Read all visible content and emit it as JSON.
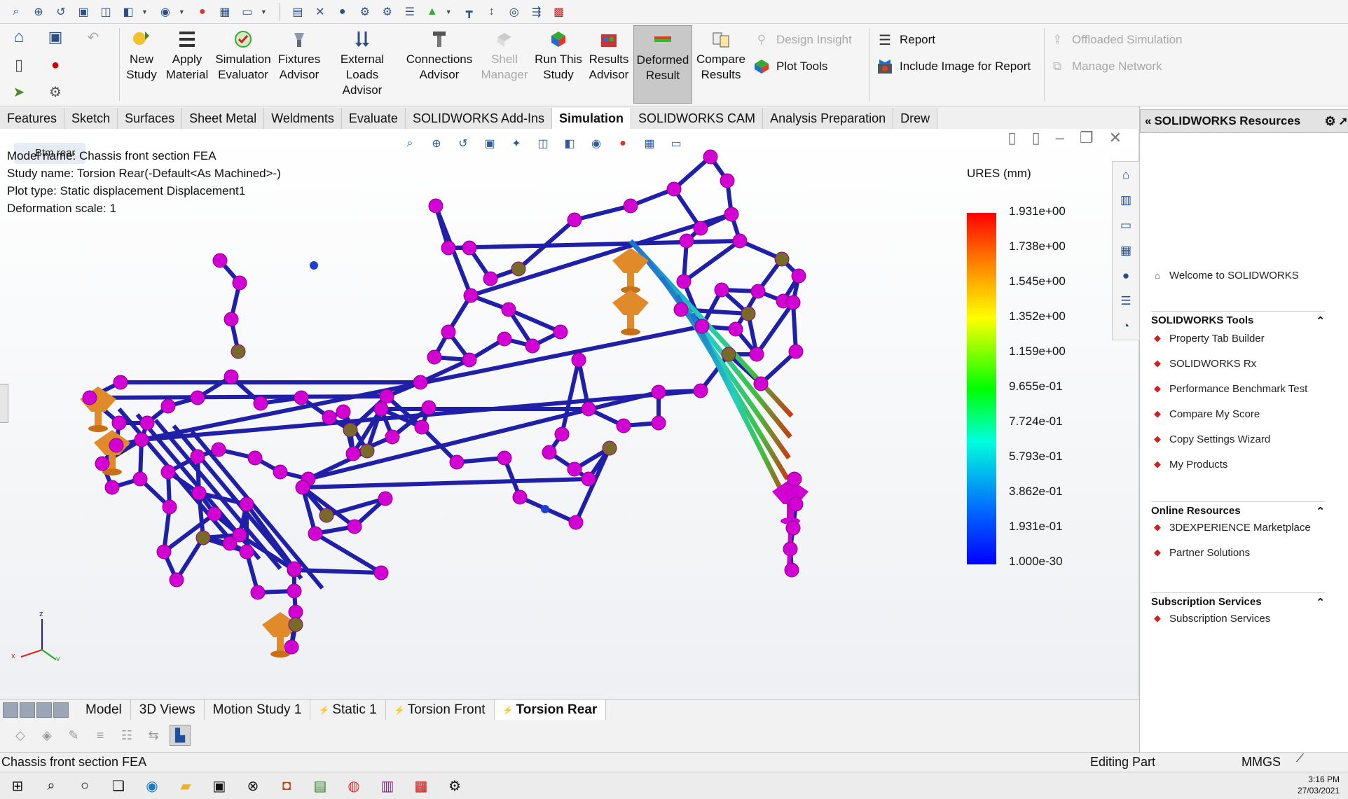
{
  "ribbon": {
    "new_study": "New\nStudy",
    "apply_material": "Apply\nMaterial",
    "simulation_evaluator": "Simulation\nEvaluator",
    "fixtures_advisor": "Fixtures\nAdvisor",
    "external_loads_advisor": "External\nLoads Advisor",
    "connections_advisor": "Connections\nAdvisor",
    "shell_manager": "Shell\nManager",
    "run_this_study": "Run This\nStudy",
    "results_advisor": "Results\nAdvisor",
    "deformed_result": "Deformed\nResult",
    "compare_results": "Compare\nResults",
    "design_insight": "Design Insight",
    "plot_tools": "Plot Tools",
    "report": "Report",
    "include_image": "Include Image for Report",
    "offloaded_simulation": "Offloaded Simulation",
    "manage_network": "Manage Network"
  },
  "command_tabs": [
    "Features",
    "Sketch",
    "Surfaces",
    "Sheet Metal",
    "Weldments",
    "Evaluate",
    "SOLIDWORKS Add-Ins",
    "Simulation",
    "SOLIDWORKS CAM",
    "Analysis Preparation",
    "Drew"
  ],
  "active_command_tab": "Simulation",
  "viewport": {
    "flyout_tag": "Btm rear",
    "model_name": "Model name: Chassis front section FEA",
    "study_name": "Study name: Torsion Rear(-Default<As Machined>-)",
    "plot_type": "Plot type: Static displacement Displacement1",
    "deformation_scale": "Deformation scale: 1"
  },
  "legend": {
    "title": "URES (mm)",
    "labels": [
      "1.931e+00",
      "1.738e+00",
      "1.545e+00",
      "1.352e+00",
      "1.159e+00",
      "9.655e-01",
      "7.724e-01",
      "5.793e-01",
      "3.862e-01",
      "1.931e-01",
      "1.000e-30"
    ],
    "colors": [
      "#ff0000",
      "#ff8800",
      "#ffff00",
      "#00ff00",
      "#00ffdd",
      "#0066ff",
      "#0000ff"
    ]
  },
  "triad": {
    "x": "x",
    "y": "y",
    "z": "z"
  },
  "model_tabs": [
    "Model",
    "3D Views",
    "Motion Study 1",
    "Static 1",
    "Torsion Front",
    "Torsion Rear"
  ],
  "active_model_tab": "Torsion Rear",
  "status": {
    "left": "Chassis front section FEA",
    "mode": "Editing Part",
    "units": "MMGS"
  },
  "clock": {
    "time": "3:16 PM",
    "date": "27/03/2021"
  },
  "task_pane": {
    "title": "SOLIDWORKS Resources",
    "welcome": "Welcome to SOLIDWORKS",
    "tools_header": "SOLIDWORKS Tools",
    "tools": [
      "Property Tab Builder",
      "SOLIDWORKS Rx",
      "Performance Benchmark Test",
      "Compare My Score",
      "Copy Settings Wizard",
      "My Products"
    ],
    "online_header": "Online Resources",
    "online": [
      "3DEXPERIENCE Marketplace",
      "Partner Solutions"
    ],
    "subscription_header": "Subscription Services",
    "subscription": [
      "Subscription Services"
    ]
  },
  "colors": {
    "node": "#d200d2",
    "tube": "#1f1fa8",
    "fixture": "#e08a2a"
  }
}
